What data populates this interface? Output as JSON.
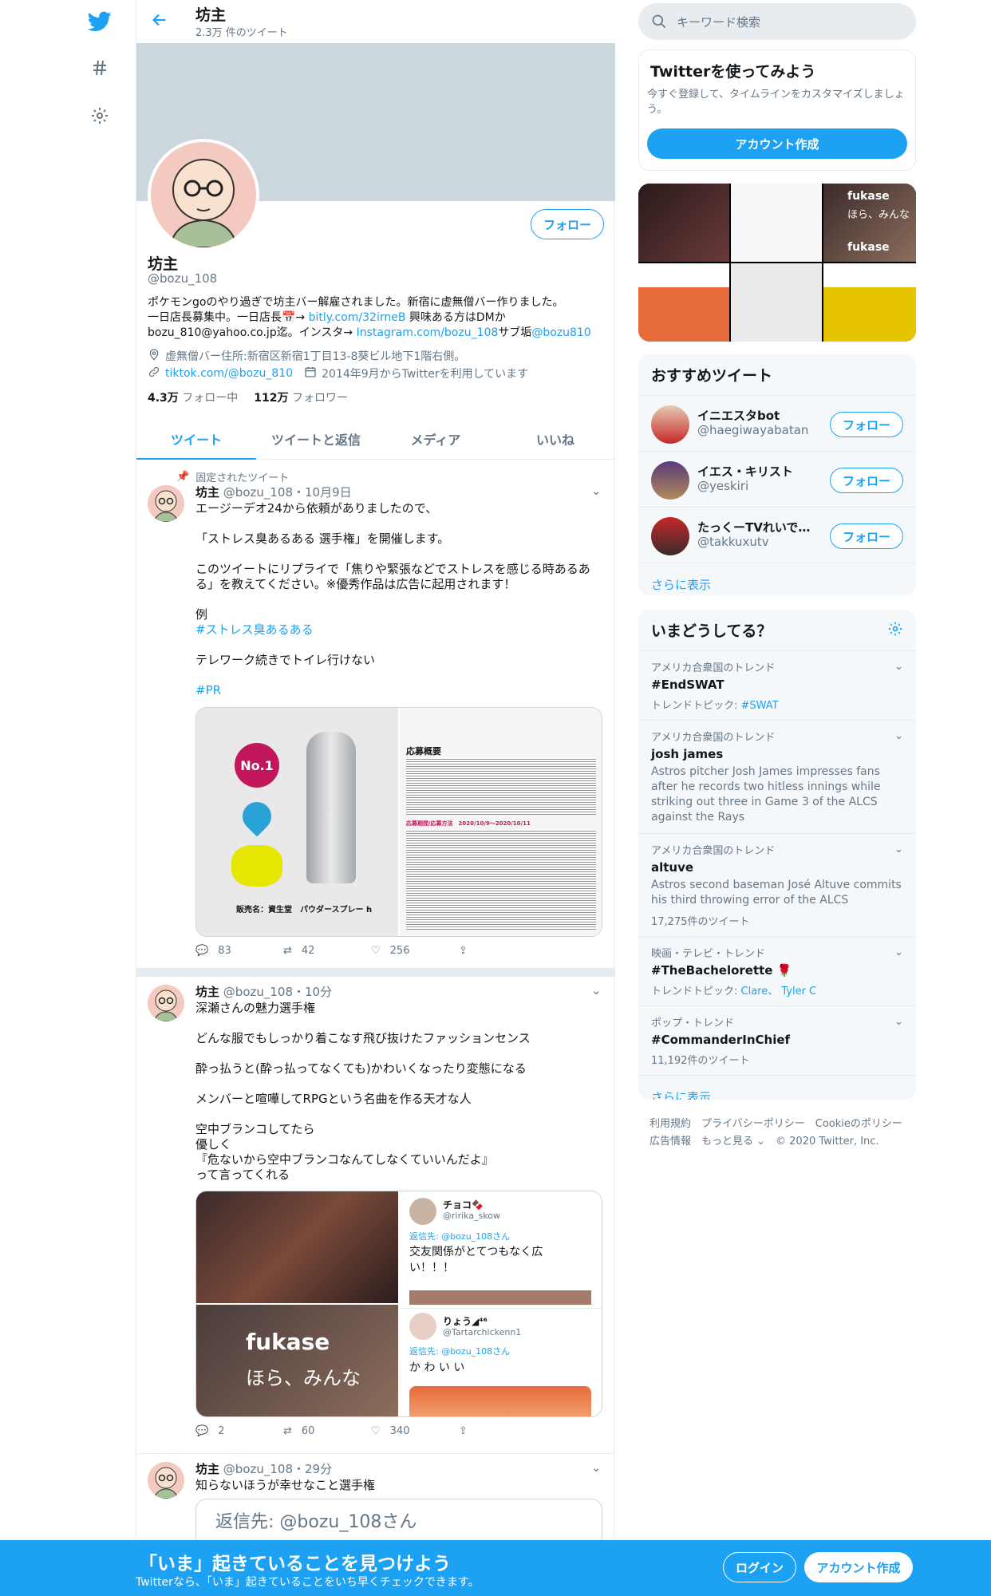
{
  "header": {
    "title": "坊主",
    "tweet_count": "2.3万 件のツイート"
  },
  "profile": {
    "name": "坊主",
    "handle": "@bozu_108",
    "follow_label": "フォロー",
    "bio_1": "ポケモンgoのやり過ぎで坊主バー解雇されました。新宿に虚無僧バー作りました。",
    "bio_2": "一日店長募集中。一日店長📅→ ",
    "bio_link1": "bitly.com/32irneB",
    "bio_3": " 興味ある方はDMか",
    "bio_4": "bozu_810@yahoo.co.jp迄。インスタ→ ",
    "bio_link2": "Instagram.com/bozu_108",
    "bio_5": "サブ垢",
    "bio_link3": "@bozu810",
    "location": "虚無僧バー住所:新宿区新宿1丁目13-8葵ビル地下1階右側。",
    "website": "tiktok.com/@bozu_810",
    "joined": "2014年9月からTwitterを利用しています",
    "following_count": "4.3万",
    "following_label": "フォロー中",
    "followers_count": "112万",
    "followers_label": "フォロワー"
  },
  "tabs": [
    "ツイート",
    "ツイートと返信",
    "メディア",
    "いいね"
  ],
  "tweets": [
    {
      "pinned_label": "固定されたツイート",
      "name": "坊主",
      "handle": "@bozu_108",
      "time": "・10月9日",
      "text_1": "エージーデオ24から依頼がありましたので、\n\n「ストレス臭あるある 選手権」を開催します。\n\nこのツイートにリプライで「焦りや緊張などでストレスを感じる時あるある」を教えてください。※優秀作品は広告に起用されます！\n\n例",
      "hashtag_1": "#ストレス臭あるある",
      "text_2": "テレワーク続きでトイレ行けない",
      "hashtag_2": "#PR",
      "media_left_caption": "販売名：資生堂　パウダースプレー h",
      "media_left_badge": "No.1",
      "media_right_title": "応募概要",
      "media_right_dates": "応募期間/応募方法　2020/10/9～2020/10/11",
      "replies": "83",
      "retweets": "42",
      "likes": "256"
    },
    {
      "name": "坊主",
      "handle": "@bozu_108",
      "time": "・10分",
      "text": "深瀬さんの魅力選手権\n\nどんな服でもしっかり着こなす飛び抜けたファッションセンス\n\n酔っ払うと(酔っ払ってなくても)かわいくなったり変態になる\n\nメンバーと喧嘩してRPGという名曲を作る天才な人\n\n空中ブランコしてたら\n優しく\n『危ないから空中ブランコなんてしなくていいんだよ』\nって言ってくれる",
      "media_fukase": "fukase",
      "media_fukase_sub": "ほら、みんな",
      "reply1_name": "チョコ🍫",
      "reply1_handle": "@ririka_skow",
      "reply1_to": "返信先: @bozu_108さん",
      "reply1_text": "交友関係がとてつもなく広い！！！",
      "reply2_name": "りょう◢⁴⁶",
      "reply2_handle": "@Tartarchickenn1",
      "reply2_to": "返信先: @bozu_108さん",
      "reply2_text": "か わ い い",
      "replies": "2",
      "retweets": "60",
      "likes": "340"
    },
    {
      "name": "坊主",
      "handle": "@bozu_108",
      "time": "・29分",
      "text": "知らないほうが幸せなこと選手権",
      "quote_text": "返信先: @bozu_108さん"
    }
  ],
  "search": {
    "placeholder": "キーワード検索"
  },
  "signup_card": {
    "title": "Twitterを使ってみよう",
    "desc": "今すぐ登録して、タイムラインをカスタマイズしましょう。",
    "button": "アカウント作成"
  },
  "media_grid": {
    "fukase1": "fukase",
    "fukase1_sub": "ほら、みんな",
    "fukase2": "fukase"
  },
  "recommend": {
    "title": "おすすめツイート",
    "items": [
      {
        "name": "イニエスタbot",
        "handle": "@haegiwayabatan",
        "button": "フォロー"
      },
      {
        "name": "イエス・キリスト",
        "handle": "@yeskiri",
        "button": "フォロー"
      },
      {
        "name": "たっくーTVれいでぃ…",
        "handle": "@takkuxutv",
        "button": "フォロー"
      }
    ],
    "more": "さらに表示"
  },
  "trends": {
    "title": "いまどうしてる？",
    "items": [
      {
        "meta": "アメリカ合衆国のトレンド",
        "name": "#EndSWAT",
        "topic_label": "トレンドトピック: ",
        "topic_links": "#SWAT"
      },
      {
        "meta": "アメリカ合衆国のトレンド",
        "name": "josh james",
        "desc": "Astros pitcher Josh James impresses fans after he records two hitless innings while striking out three in Game 3 of the ALCS against the Rays"
      },
      {
        "meta": "アメリカ合衆国のトレンド",
        "name": "altuve",
        "desc": "Astros second baseman José Altuve commits his third throwing error of the ALCS",
        "count": "17,275件のツイート"
      },
      {
        "meta": "映画・テレビ・トレンド",
        "name": "#TheBachelorette 🌹",
        "topic_label": "トレンドトピック: ",
        "topic_links": "Clare、 Tyler C"
      },
      {
        "meta": "ポップ・トレンド",
        "name": "#CommanderInChief",
        "count": "11,192件のツイート"
      }
    ],
    "more": "さらに表示"
  },
  "footer": {
    "line1": "利用規約　プライバシーポリシー　Cookieのポリシー",
    "line2": "広告情報　もっと見る ⌄　© 2020 Twitter, Inc."
  },
  "bottom_bar": {
    "title": "「いま」起きていることを見つけよう",
    "subtitle": "Twitterなら、「いま」起きていることをいち早くチェックできます。",
    "login": "ログイン",
    "signup": "アカウント作成"
  },
  "colors": {
    "accent": "#1da1f2",
    "banner": "#ccd6dd",
    "bottom_bar": "#1da1f2"
  }
}
